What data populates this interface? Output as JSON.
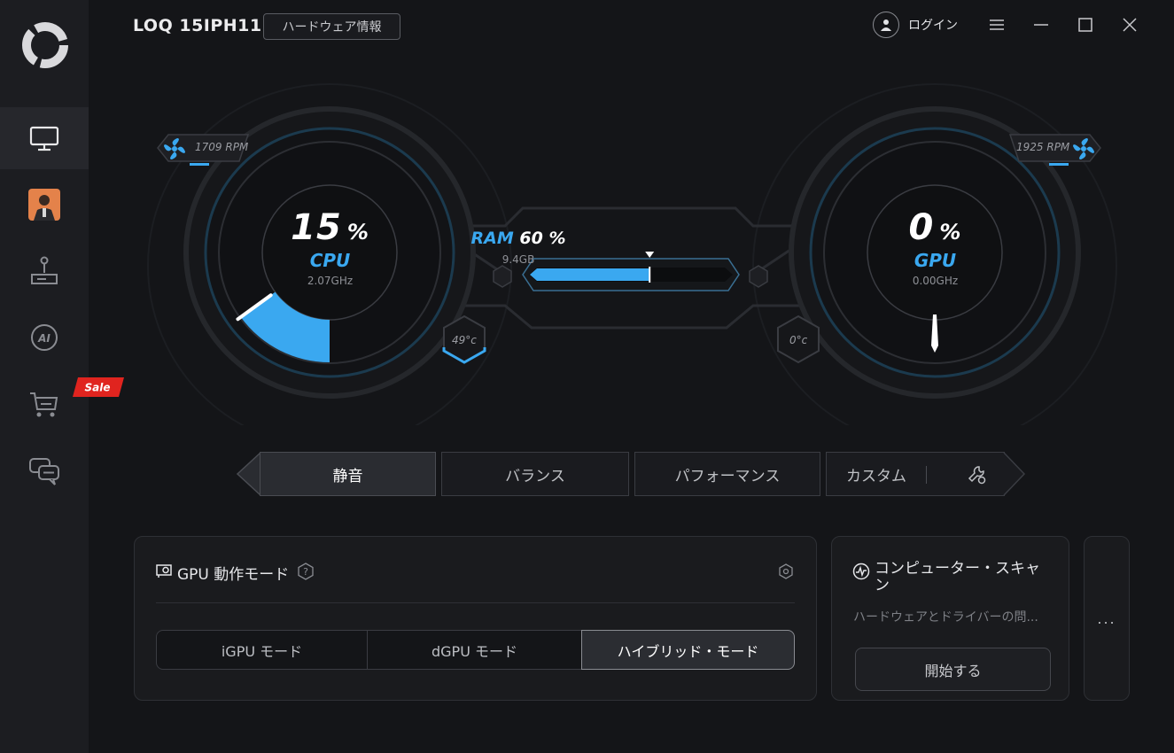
{
  "app": {
    "device_name": "LOQ 15IPH11",
    "hardware_info_label": "ハードウェア情報",
    "login_label": "ログイン"
  },
  "sidebar": {
    "sale_badge": "Sale",
    "items": [
      {
        "icon": "monitor-icon",
        "active": true
      },
      {
        "icon": "avatar-icon",
        "active": false
      },
      {
        "icon": "joystick-icon",
        "active": false
      },
      {
        "icon": "ai-icon",
        "active": false
      },
      {
        "icon": "cart-icon",
        "active": false
      },
      {
        "icon": "chat-icon",
        "active": false
      }
    ]
  },
  "dashboard": {
    "cpu": {
      "value": "15",
      "unit": "%",
      "label": "CPU",
      "freq": "2.07GHz",
      "fan_rpm": "1709 RPM",
      "temp": "49°c",
      "load_fraction": 0.15
    },
    "gpu": {
      "value": "0",
      "unit": "%",
      "label": "GPU",
      "freq": "0.00GHz",
      "fan_rpm": "1925 RPM",
      "temp": "0°c",
      "load_fraction": 0.0
    },
    "ram": {
      "label": "RAM",
      "value": "60 %",
      "size": "9.4GB",
      "fraction": 0.6
    }
  },
  "modes": {
    "items": [
      "静音",
      "バランス",
      "パフォーマンス",
      "カスタム"
    ],
    "active_index": 0
  },
  "gpu_mode_card": {
    "title": "GPU 動作モード",
    "options": [
      "iGPU モード",
      "dGPU モード",
      "ハイブリッド・モード"
    ],
    "active_index": 2
  },
  "scan_card": {
    "title_line1": "コンピューター・スキャ",
    "title_line2": "ン",
    "description": "ハードウェアとドライバーの問...",
    "start_label": "開始する"
  },
  "more_label": "...",
  "colors": {
    "accent": "#3aa8f0",
    "background": "#141518",
    "sidebar": "#1c1d21",
    "sale": "#e0241f"
  }
}
